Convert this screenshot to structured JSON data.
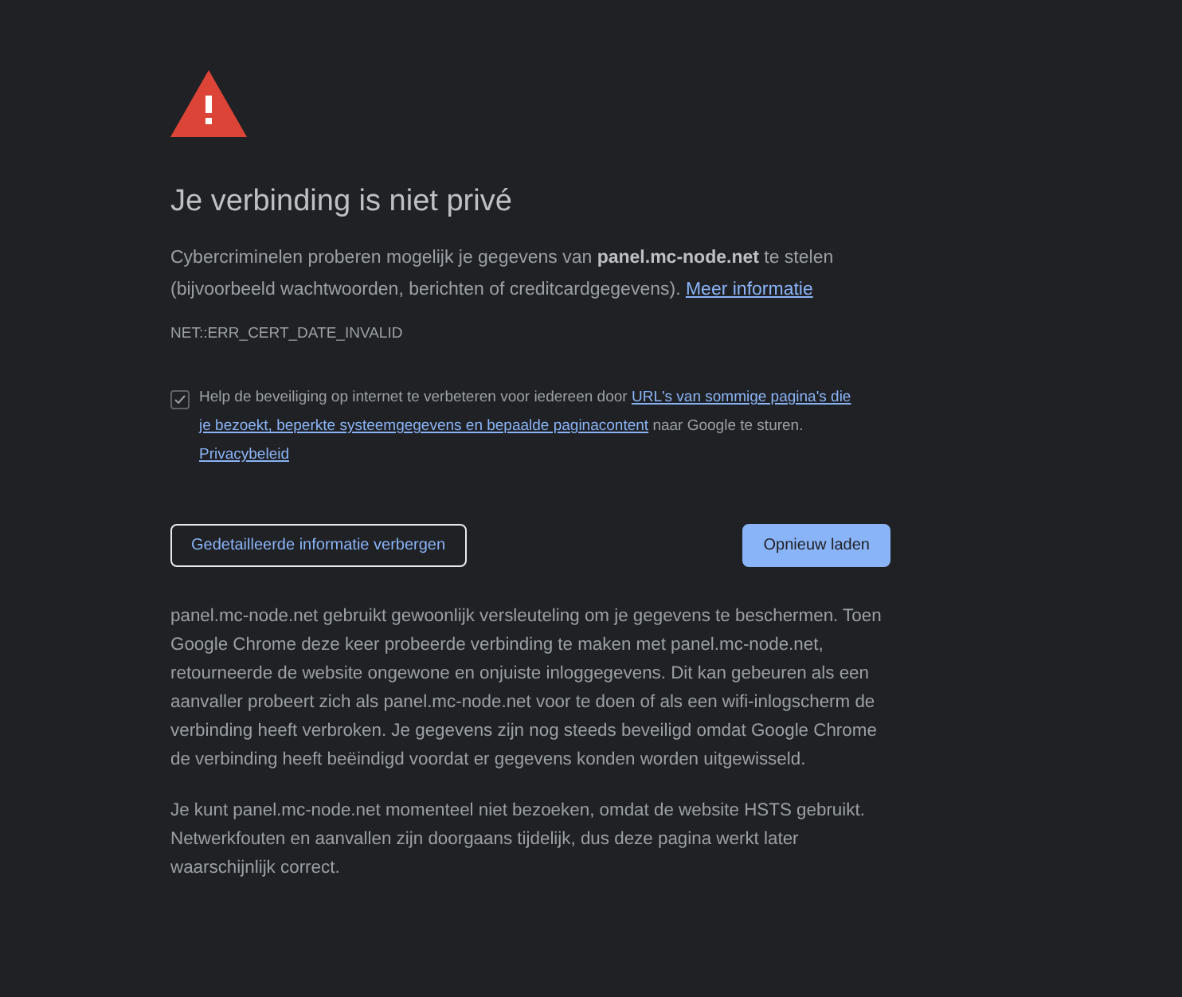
{
  "heading": "Je verbinding is niet privé",
  "intro": {
    "text": "Cybercriminelen proberen mogelijk je gegevens van **panel.mc-node.net** te stelen (bijvoorbeeld wachtwoorden, berichten of creditcardgegevens).",
    "link": "Meer informatie"
  },
  "error_code": "NET::ERR_CERT_DATE_INVALID",
  "report_option": {
    "checked": true,
    "text_before": "Help de beveiliging op internet te verbeteren voor iedereen door",
    "link_lines": [
      "URL's van sommige pagina's die",
      "je bezoekt, beperkte systeemgegevens en bepaalde paginacontent"
    ],
    "text_after": "naar Google te sturen.",
    "privacy_link": "Privacybeleid"
  },
  "buttons": [
    {
      "kind": "secondary",
      "label": "Gedetailleerde informatie verbergen"
    },
    {
      "kind": "primary",
      "label": "Opnieuw laden"
    }
  ],
  "details": [
    "panel.mc-node.net gebruikt gewoonlijk versleuteling om je gegevens te beschermen. Toen Google Chrome deze keer probeerde verbinding te maken met panel.mc-node.net, retourneerde de website ongewone en onjuiste inloggegevens. Dit kan gebeuren als een aanvaller probeert zich als panel.mc-node.net voor te doen of als een wifi-inlogscherm de verbinding heeft verbroken. Je gegevens zijn nog steeds beveiligd omdat Google Chrome de verbinding heeft beëindigd voordat er gegevens konden worden uitgewisseld.",
    "Je kunt panel.mc-node.net momenteel niet bezoeken, omdat de website HSTS gebruikt. Netwerkfouten en aanvallen zijn doorgaans tijdelijk, dus deze pagina werkt later waarschijnlijk correct."
  ]
}
